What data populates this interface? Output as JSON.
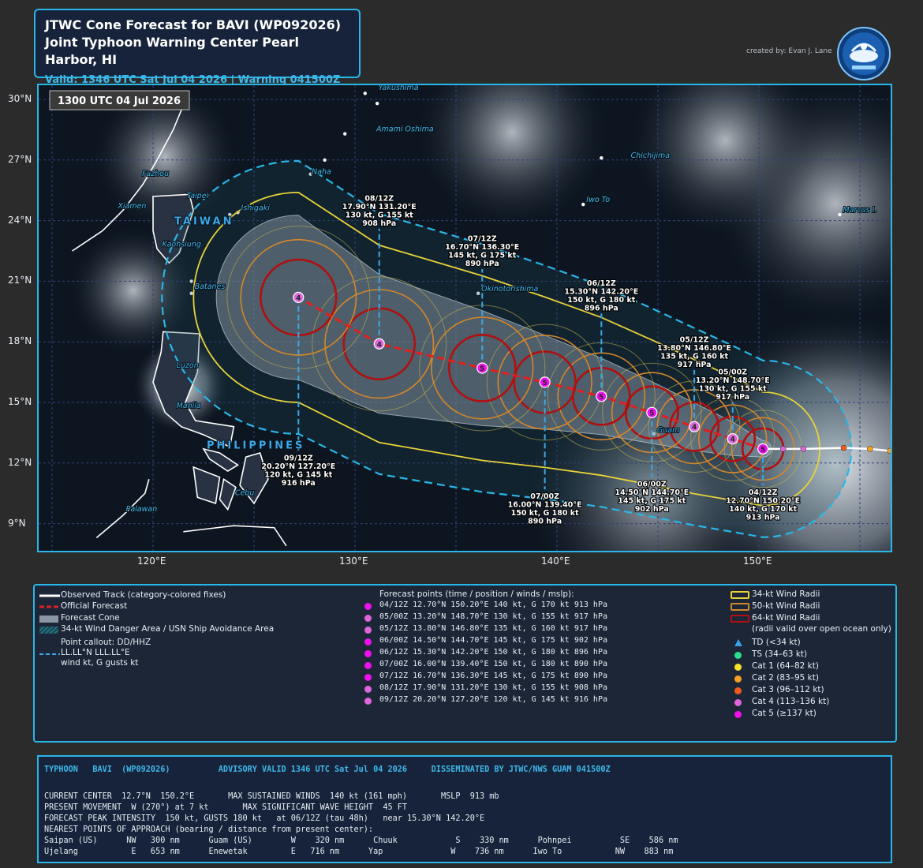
{
  "title": {
    "line1": "JTWC Cone Forecast for BAVI (WP092026)",
    "line2": "Joint Typhoon Warning Center Pearl Harbor, HI",
    "line3": "Valid: 1346 UTC Sat Jul 04 2026 | Warning 041500Z"
  },
  "credit": "created by: Evan J. Lane",
  "map": {
    "timestamp": "1300 UTC 04 Jul 2026",
    "lat_ticks": [
      "30°N",
      "27°N",
      "24°N",
      "21°N",
      "18°N",
      "15°N",
      "12°N",
      "9°N"
    ],
    "lon_ticks": [
      "120°E",
      "130°E",
      "140°E",
      "150°E"
    ],
    "places": [
      {
        "name": "Yakushima",
        "lat": 30.35,
        "lon": 131.0
      },
      {
        "name": "Amami Oshima",
        "lat": 28.3,
        "lon": 130.9
      },
      {
        "name": "Chichijima",
        "lat": 27.0,
        "lon": 143.5
      },
      {
        "name": "Fuzhou",
        "lat": 26.1,
        "lon": 119.3
      },
      {
        "name": "Naha",
        "lat": 26.2,
        "lon": 127.7
      },
      {
        "name": "Taipei",
        "lat": 25.0,
        "lon": 121.5
      },
      {
        "name": "Iwo To",
        "lat": 24.8,
        "lon": 141.3
      },
      {
        "name": "Xiamen",
        "lat": 24.5,
        "lon": 118.1
      },
      {
        "name": "Ishigaki",
        "lat": 24.4,
        "lon": 124.2
      },
      {
        "name": "Marcus I.",
        "lat": 24.3,
        "lon": 154.0
      },
      {
        "name": "TAIWAN",
        "lat": 23.7,
        "lon": 120.9
      },
      {
        "name": "Kaohsiung",
        "lat": 22.6,
        "lon": 120.3
      },
      {
        "name": "Batanes",
        "lat": 20.5,
        "lon": 121.9
      },
      {
        "name": "Okinotorishima",
        "lat": 20.4,
        "lon": 136.1
      },
      {
        "name": "Luzon",
        "lat": 16.6,
        "lon": 121.0
      },
      {
        "name": "Manila",
        "lat": 14.6,
        "lon": 121.0
      },
      {
        "name": "Guam",
        "lat": 13.4,
        "lon": 144.8
      },
      {
        "name": "PHILIPPINES",
        "lat": 12.6,
        "lon": 122.5
      },
      {
        "name": "Cebu",
        "lat": 10.3,
        "lon": 123.9
      },
      {
        "name": "Palawan",
        "lat": 9.5,
        "lon": 118.5
      }
    ],
    "observed_track": [
      {
        "lat": 12.6,
        "lon": 156.5,
        "cat": "cat2"
      },
      {
        "lat": 12.7,
        "lon": 155.5,
        "cat": "cat2"
      },
      {
        "lat": 12.75,
        "lon": 154.2,
        "cat": "cat3"
      },
      {
        "lat": 12.7,
        "lon": 152.2,
        "cat": "cat4"
      },
      {
        "lat": 12.7,
        "lon": 151.2,
        "cat": "cat4"
      }
    ],
    "callouts": [
      {
        "time": "04/12Z",
        "pos": "12.70°N  150.20°E",
        "wind": "140 kt, G 170 kt",
        "mslp": "913 hPa",
        "lat": 12.7,
        "lon": 150.2,
        "cat": "5",
        "side": "below",
        "clat": 10.9
      },
      {
        "time": "05/00Z",
        "pos": "13.20°N  148.70°E",
        "wind": "130 kt, G 155 kt",
        "mslp": "917 hPa",
        "lat": 13.2,
        "lon": 148.7,
        "cat": "4",
        "side": "above",
        "clat": 15.0
      },
      {
        "time": "05/12Z",
        "pos": "13.80°N  146.80°E",
        "wind": "135 kt, G 160 kt",
        "mslp": "917 hPa",
        "lat": 13.8,
        "lon": 146.8,
        "cat": "4",
        "side": "above",
        "clat": 16.6
      },
      {
        "time": "06/00Z",
        "pos": "14.50°N  144.70°E",
        "wind": "145 kt, G 175 kt",
        "mslp": "902 hPa",
        "lat": 14.5,
        "lon": 144.7,
        "cat": "5",
        "side": "below",
        "clat": 11.3
      },
      {
        "time": "06/12Z",
        "pos": "15.30°N  142.20°E",
        "wind": "150 kt, G 180 kt",
        "mslp": "896 hPa",
        "lat": 15.3,
        "lon": 142.2,
        "cat": "5",
        "side": "above",
        "clat": 19.4
      },
      {
        "time": "07/00Z",
        "pos": "16.00°N  139.40°E",
        "wind": "150 kt, G 180 kt",
        "mslp": "890 hPa",
        "lat": 16.0,
        "lon": 139.4,
        "cat": "5",
        "side": "below",
        "clat": 10.7
      },
      {
        "time": "07/12Z",
        "pos": "16.70°N  136.30°E",
        "wind": "145 kt, G 175 kt",
        "mslp": "890 hPa",
        "lat": 16.7,
        "lon": 136.3,
        "cat": "5",
        "side": "above",
        "clat": 21.6
      },
      {
        "time": "08/12Z",
        "pos": "17.90°N  131.20°E",
        "wind": "130 kt, G 155 kt",
        "mslp": "908 hPa",
        "lat": 17.9,
        "lon": 131.2,
        "cat": "4",
        "side": "above",
        "clat": 23.6
      },
      {
        "time": "09/12Z",
        "pos": "20.20°N  127.20°E",
        "wind": "120 kt, G 145 kt",
        "mslp": "916 hPa",
        "lat": 20.2,
        "lon": 127.2,
        "cat": "4",
        "side": "below",
        "clat": 12.6
      }
    ]
  },
  "legend": {
    "col1": [
      {
        "label": "Observed Track (category-colored fixes)",
        "icon": "white-line"
      },
      {
        "label": "Official Forecast",
        "icon": "red-dash"
      },
      {
        "label": "Forecast Cone",
        "icon": "gray-box"
      },
      {
        "label": "34-kt Wind Danger Area / USN Ship Avoidance Area",
        "icon": "teal-hatch"
      }
    ],
    "callout_lines": [
      "Point callout:  DD/HHZ",
      "LL.LL°N LLL.LL°E",
      "wind kt, G gusts kt"
    ],
    "fp_header": "Forecast points (time / position / winds / mslp):",
    "forecast_points": [
      {
        "text": "04/12Z  12.70°N 150.20°E  140 kt, G 170 kt    913  hPa",
        "color": "#ee11ee"
      },
      {
        "text": "05/00Z  13.20°N 148.70°E  130 kt, G 155 kt    917  hPa",
        "color": "#dd66dd"
      },
      {
        "text": "05/12Z  13.80°N 146.80°E  135 kt, G 160 kt    917  hPa",
        "color": "#dd66dd"
      },
      {
        "text": "06/00Z  14.50°N 144.70°E  145 kt, G 175 kt    902  hPa",
        "color": "#ee11ee"
      },
      {
        "text": "06/12Z  15.30°N 142.20°E  150 kt, G 180 kt    896  hPa",
        "color": "#ee11ee"
      },
      {
        "text": "07/00Z  16.00°N 139.40°E  150 kt, G 180 kt    890  hPa",
        "color": "#ee11ee"
      },
      {
        "text": "07/12Z  16.70°N 136.30°E  145 kt, G 175 kt    890  hPa",
        "color": "#ee11ee"
      },
      {
        "text": "08/12Z  17.90°N 131.20°E  130 kt, G 155 kt    908  hPa",
        "color": "#dd66dd"
      },
      {
        "text": "09/12Z  20.20°N 127.20°E  120 kt, G 145 kt    916  hPa",
        "color": "#dd66dd"
      }
    ],
    "radii": [
      {
        "label": "34-kt Wind Radii",
        "color": "#e8d23a"
      },
      {
        "label": "50-kt Wind Radii",
        "color": "#d4872a"
      },
      {
        "label": "64-kt Wind Radii",
        "color": "#b01010"
      }
    ],
    "radii_note": "(radii valid over open ocean only)",
    "categories": [
      {
        "label": "TD (<34 kt)",
        "color": "#3aa0e8",
        "shape": "triangle"
      },
      {
        "label": "TS (34–63 kt)",
        "color": "#28e08a",
        "shape": "dot"
      },
      {
        "label": "Cat 1 (64–82 kt)",
        "color": "#f5e12a",
        "shape": "dot"
      },
      {
        "label": "Cat 2 (83–95 kt)",
        "color": "#f5a020",
        "shape": "dot"
      },
      {
        "label": "Cat 3 (96–112 kt)",
        "color": "#f05a1a",
        "shape": "dot"
      },
      {
        "label": "Cat 4 (113–136 kt)",
        "color": "#dd66dd",
        "shape": "dot"
      },
      {
        "label": "Cat 5 (≥137 kt)",
        "color": "#ee11ee",
        "shape": "dot"
      }
    ]
  },
  "advisory": {
    "header": "TYPHOON   BAVI  (WP092026)          ADVISORY VALID 1346 UTC Sat Jul 04 2026     DISSEMINATED BY JTWC/NWS GUAM 041500Z",
    "lines": [
      "CURRENT CENTER  12.7°N  150.2°E       MAX SUSTAINED WINDS  140 kt (161 mph)       MSLP  913 mb",
      "PRESENT MOVEMENT  W (270°) at 7 kt       MAX SIGNIFICANT WAVE HEIGHT  45 FT",
      "FORECAST PEAK INTENSITY  150 kt, GUSTS 180 kt   at 06/12Z (tau 48h)   near 15.30°N 142.20°E",
      "NEAREST POINTS OF APPROACH (bearing / distance from present center):",
      "Saipan (US)      NW   300 nm      Guam (US)        W    320 nm      Chuuk            S    330 nm      Pohnpei          SE    586 nm",
      "Ujelang           E   653 nm      Enewetak         E   716 nm      Yap              W    736 nm      Iwo To           NW    883 nm"
    ]
  }
}
